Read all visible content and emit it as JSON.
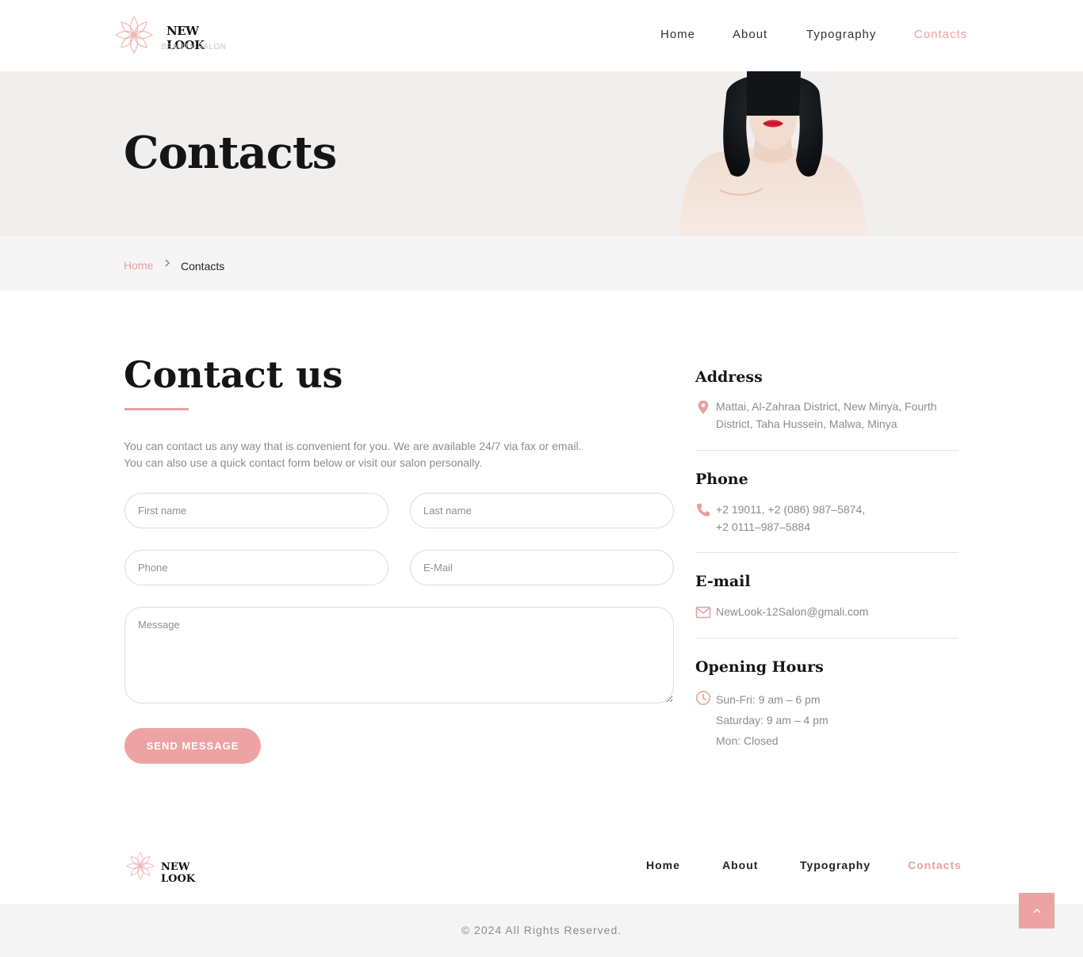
{
  "brand": {
    "name": "NEW LOOK",
    "tagline": "BEAUTY SALON"
  },
  "nav": {
    "items": [
      {
        "label": "Home"
      },
      {
        "label": "About"
      },
      {
        "label": "Typography"
      },
      {
        "label": "Contacts",
        "active": true
      }
    ]
  },
  "hero": {
    "title": "Contacts"
  },
  "breadcrumb": {
    "home": "Home",
    "current": "Contacts"
  },
  "contact": {
    "title": "Contact us",
    "intro_line1": "You can contact us any way that is convenient for you. We are available 24/7 via fax or email.",
    "intro_line2": "You can also use a quick contact form below or visit our salon personally.",
    "form": {
      "first_name": {
        "placeholder": "First name",
        "value": ""
      },
      "last_name": {
        "placeholder": "Last name",
        "value": ""
      },
      "phone": {
        "placeholder": "Phone",
        "value": ""
      },
      "email": {
        "placeholder": "E-Mail",
        "value": ""
      },
      "message": {
        "placeholder": "Message",
        "value": ""
      },
      "submit_label": "SEND MESSAGE"
    }
  },
  "info": {
    "address": {
      "heading": "Address",
      "icon": "map-pin-icon",
      "line1": "Mattai, Al-Zahraa District, New Minya, Fourth",
      "line2": "District, Taha Hussein, Malwa, Minya"
    },
    "phone": {
      "heading": "Phone",
      "icon": "phone-icon",
      "line1": "+2 19011, +2 (086) 987–5874,",
      "line2": "+2 0111–987–5884"
    },
    "email": {
      "heading": "E-mail",
      "icon": "mail-icon",
      "value": "NewLook-12Salon@gmali.com"
    },
    "hours": {
      "heading": "Opening Hours",
      "icon": "clock-icon",
      "lines": [
        "Sun-Fri: 9 am – 6 pm",
        "Saturday: 9 am – 4 pm",
        "Mon: Closed"
      ]
    }
  },
  "footer": {
    "brand": "NEW LOOK",
    "nav": [
      {
        "label": "Home"
      },
      {
        "label": "About"
      },
      {
        "label": "Typography"
      },
      {
        "label": "Contacts",
        "active": true
      }
    ],
    "copyright": "©  2024 All Rights Reserved.",
    "back_to_top_icon": "chevron-up-icon"
  },
  "colors": {
    "accent": "#e9a0a0",
    "button": "#eda3a3",
    "hero_bg": "#f1eeee",
    "breadcrumb_bg": "#f5f5f5",
    "muted_text": "#8c8c8c"
  }
}
